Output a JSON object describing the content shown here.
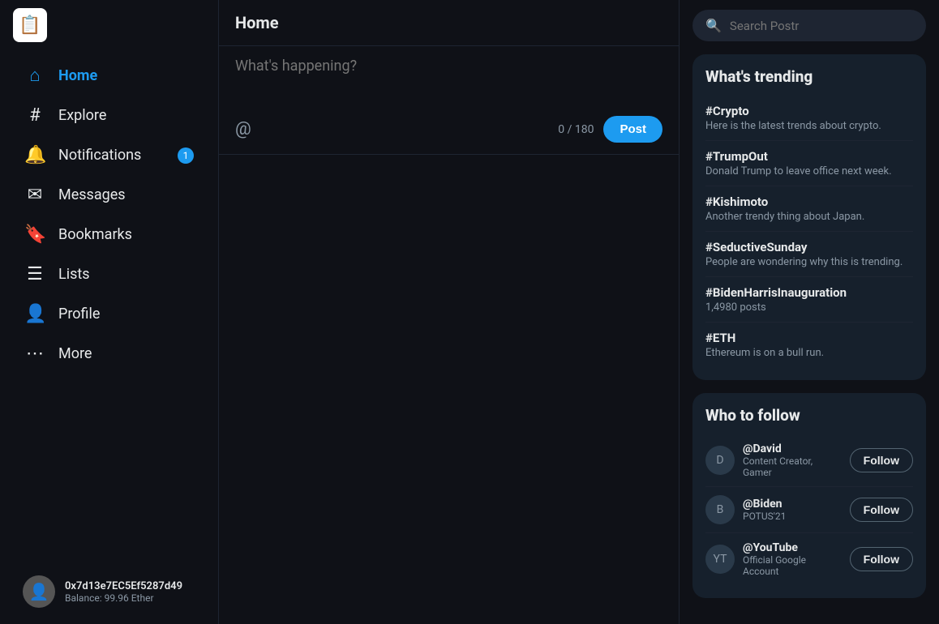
{
  "app": {
    "logo": "📋",
    "title": "Home"
  },
  "sidebar": {
    "items": [
      {
        "id": "home",
        "label": "Home",
        "icon": "⌂",
        "active": true
      },
      {
        "id": "explore",
        "label": "Explore",
        "icon": "#",
        "active": false
      },
      {
        "id": "notifications",
        "label": "Notifications",
        "icon": "🔔",
        "active": false,
        "badge": 1
      },
      {
        "id": "messages",
        "label": "Messages",
        "icon": "✉",
        "active": false
      },
      {
        "id": "bookmarks",
        "label": "Bookmarks",
        "icon": "🔖",
        "active": false
      },
      {
        "id": "lists",
        "label": "Lists",
        "icon": "☰",
        "active": false
      },
      {
        "id": "profile",
        "label": "Profile",
        "icon": "👤",
        "active": false
      },
      {
        "id": "more",
        "label": "More",
        "icon": "⋯",
        "active": false
      }
    ],
    "user": {
      "address": "0x7d13e7EC5Ef5287d49",
      "balance": "Balance: 99.96 Ether"
    }
  },
  "compose": {
    "placeholder": "What's happening?",
    "char_count": "0 / 180",
    "post_label": "Post",
    "at_icon": "@"
  },
  "search": {
    "placeholder": "Search Postr"
  },
  "trending": {
    "title": "What's trending",
    "items": [
      {
        "tag": "#Crypto",
        "desc": "Here is the latest trends about crypto."
      },
      {
        "tag": "#TrumpOut",
        "desc": "Donald Trump to leave office next week."
      },
      {
        "tag": "#Kishimoto",
        "desc": "Another trendy thing about Japan."
      },
      {
        "tag": "#SeductiveSunday",
        "desc": "People are wondering why this is trending."
      },
      {
        "tag": "#BidenHarrisInauguration",
        "desc": "1,4980 posts"
      },
      {
        "tag": "#ETH",
        "desc": "Ethereum is on a bull run."
      }
    ]
  },
  "who_to_follow": {
    "title": "Who to follow",
    "follow_label": "Follow",
    "items": [
      {
        "handle": "@David",
        "desc": "Content Creator, Gamer",
        "initials": "D"
      },
      {
        "handle": "@Biden",
        "desc": "POTUS'21",
        "initials": "B"
      },
      {
        "handle": "@YouTube",
        "desc": "Official Google Account",
        "initials": "YT"
      }
    ]
  }
}
